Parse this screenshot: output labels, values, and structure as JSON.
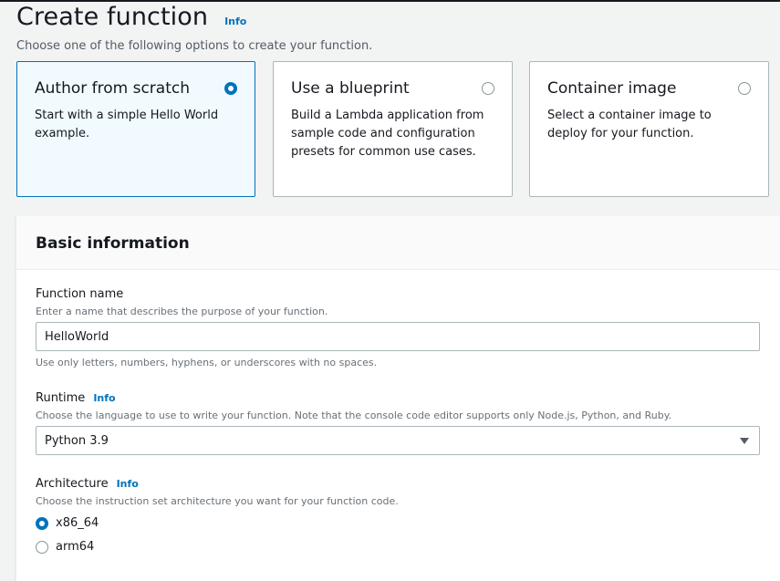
{
  "header": {
    "title": "Create function",
    "info": "Info",
    "subtitle": "Choose one of the following options to create your function."
  },
  "options": [
    {
      "title": "Author from scratch",
      "desc": "Start with a simple Hello World example.",
      "selected": true
    },
    {
      "title": "Use a blueprint",
      "desc": "Build a Lambda application from sample code and configuration presets for common use cases.",
      "selected": false
    },
    {
      "title": "Container image",
      "desc": "Select a container image to deploy for your function.",
      "selected": false
    }
  ],
  "basic": {
    "title": "Basic information",
    "function_name": {
      "label": "Function name",
      "desc": "Enter a name that describes the purpose of your function.",
      "value": "HelloWorld",
      "hint": "Use only letters, numbers, hyphens, or underscores with no spaces."
    },
    "runtime": {
      "label": "Runtime",
      "info": "Info",
      "desc": "Choose the language to use to write your function. Note that the console code editor supports only Node.js, Python, and Ruby.",
      "value": "Python 3.9"
    },
    "architecture": {
      "label": "Architecture",
      "info": "Info",
      "desc": "Choose the instruction set architecture you want for your function code.",
      "options": [
        {
          "label": "x86_64",
          "selected": true
        },
        {
          "label": "arm64",
          "selected": false
        }
      ]
    }
  },
  "colors": {
    "accent": "#0073bb",
    "selected_tile_bg": "#f1faff",
    "text": "#16191f",
    "muted": "#687078"
  }
}
